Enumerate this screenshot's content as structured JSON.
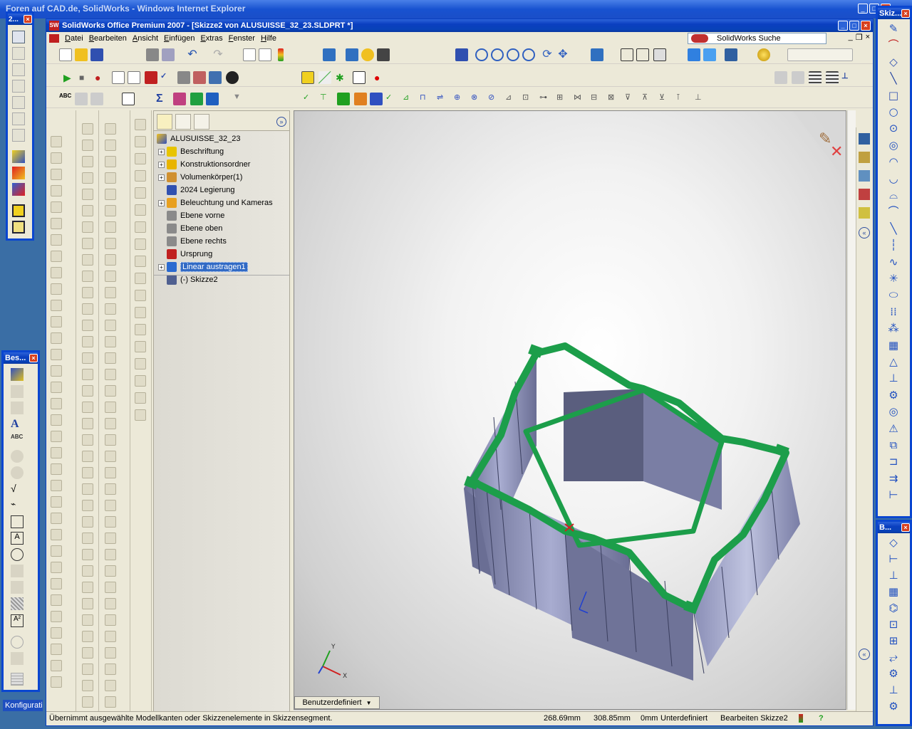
{
  "ie_window": {
    "title": "Foren auf CAD.de, SolidWorks - Windows Internet Explorer"
  },
  "sw_window": {
    "title": "SolidWorks Office Premium 2007 - [Skizze2 von ALUSUISSE_32_23.SLDPRT *]",
    "search_label": "SolidWorks Suche"
  },
  "menu": [
    "Datei",
    "Bearbeiten",
    "Ansicht",
    "Einfügen",
    "Extras",
    "Fenster",
    "Hilfe"
  ],
  "feature_tree": {
    "root": "ALUSUISSE_32_23",
    "items": [
      {
        "label": "Beschriftung",
        "expandable": true,
        "icon_color": "#e8c400"
      },
      {
        "label": "Konstruktionsordner",
        "expandable": true,
        "icon_color": "#e8b400"
      },
      {
        "label": "Volumenkörper(1)",
        "expandable": true,
        "icon_color": "#d09030"
      },
      {
        "label": "2024 Legierung",
        "expandable": false,
        "icon_color": "#3050b0"
      },
      {
        "label": "Beleuchtung und Kameras",
        "expandable": true,
        "icon_color": "#e8a020"
      },
      {
        "label": "Ebene vorne",
        "expandable": false,
        "icon_color": "#8a8a8a"
      },
      {
        "label": "Ebene oben",
        "expandable": false,
        "icon_color": "#8a8a8a"
      },
      {
        "label": "Ebene rechts",
        "expandable": false,
        "icon_color": "#8a8a8a"
      },
      {
        "label": "Ursprung",
        "expandable": false,
        "icon_color": "#c02020"
      },
      {
        "label": "Linear austragen1",
        "expandable": true,
        "icon_color": "#2a6ad0",
        "selected": true
      },
      {
        "label": "(-) Skizze2",
        "expandable": false,
        "icon_color": "#506090"
      }
    ]
  },
  "view": {
    "orientation_label": "Benutzerdefiniert",
    "model_color": "#1c9e4a",
    "body_color": "#8a8eb4"
  },
  "status_bar": {
    "message": "Übernimmt ausgewählte Modellkanten oder Skizzenelemente in Skizzensegment.",
    "x": "268.69mm",
    "y": "308.85mm",
    "z": "0mm",
    "state": "Unterdefiniert",
    "mode": "Bearbeiten Skizze2",
    "help": "?"
  },
  "palettes": {
    "left_top_title": "2...",
    "left_bottom_title": "Bes...",
    "right_top_title": "Skiz...",
    "right_bottom_title": "B...",
    "taskbar_label": "Konfiguratio"
  }
}
